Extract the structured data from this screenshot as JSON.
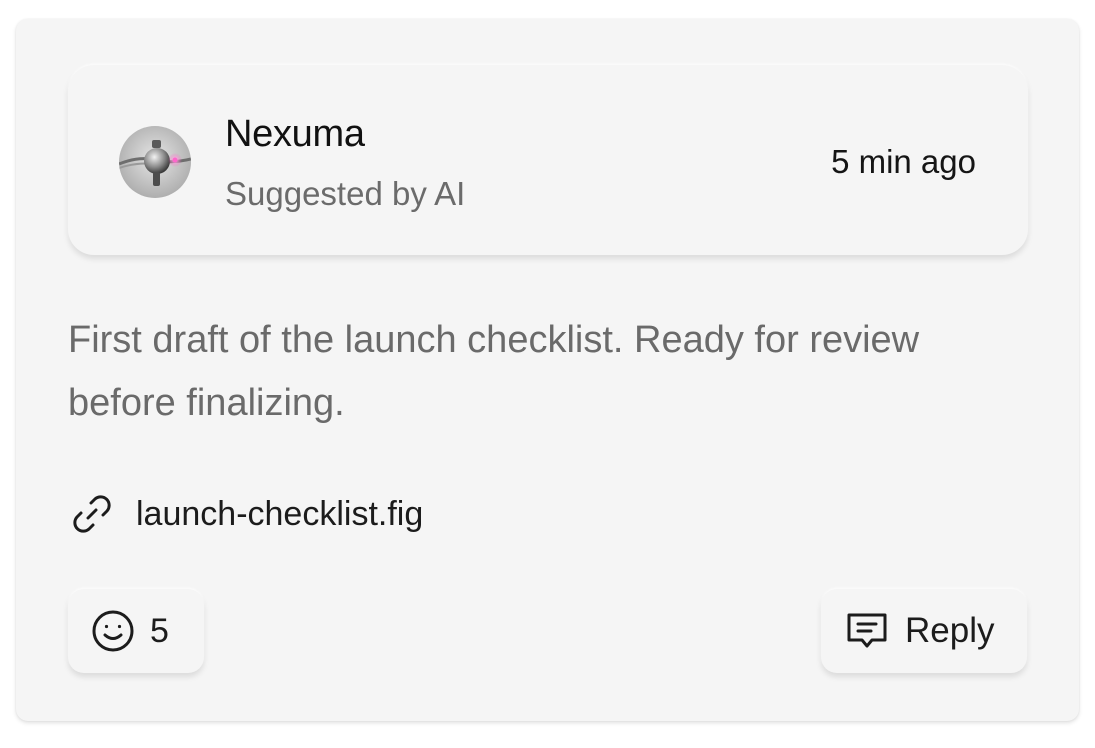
{
  "comment": {
    "author": {
      "name": "Nexuma",
      "subtitle": "Suggested by AI",
      "avatar_icon": "ai-orb-avatar"
    },
    "timestamp": "5 min ago",
    "message": "First draft of the launch checklist. Ready for review before finalizing.",
    "attachment": {
      "icon": "link-icon",
      "name": "launch-checklist.fig"
    },
    "reactions": {
      "icon": "smiley-icon",
      "count": "5"
    },
    "reply": {
      "icon": "chat-bubble-icon",
      "label": "Reply"
    }
  },
  "colors": {
    "card_background": "#f5f5f5",
    "primary_text": "#111111",
    "secondary_text": "#6b6b6b"
  }
}
